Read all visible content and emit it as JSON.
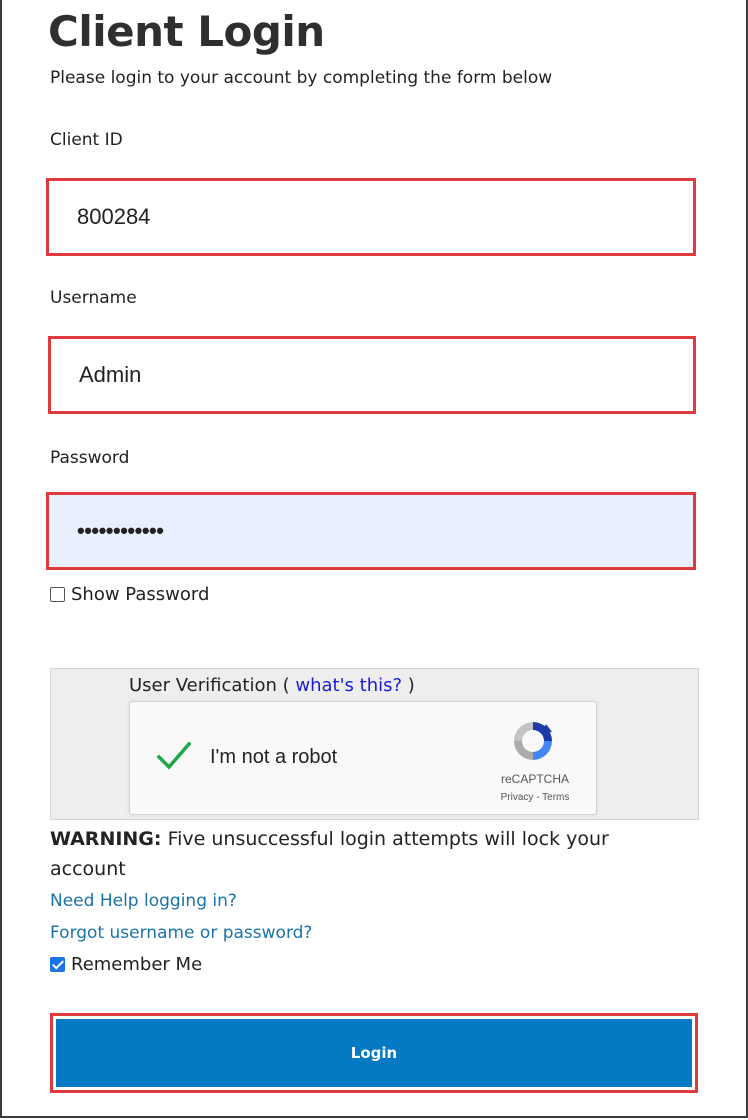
{
  "page": {
    "title": "Client Login",
    "subtitle": "Please login to your account by completing the form below"
  },
  "form": {
    "client_id": {
      "label": "Client ID",
      "value": "800284"
    },
    "username": {
      "label": "Username",
      "value": "Admin"
    },
    "password": {
      "label": "Password",
      "value": "••••••••••••"
    },
    "show_password": {
      "label": "Show Password",
      "checked": false
    }
  },
  "verification": {
    "label": "User Verification (",
    "link_text": "what's this?",
    "label_close": ")",
    "captcha_text": "I'm not a robot",
    "captcha_brand": "reCAPTCHA",
    "captcha_links": "Privacy - Terms",
    "captcha_checked": true
  },
  "warning": {
    "prefix": "WARNING:",
    "text": "Five unsuccessful login attempts will lock your account"
  },
  "links": {
    "help": "Need Help logging in?",
    "forgot": "Forgot username or password?"
  },
  "remember_me": {
    "label": "Remember Me",
    "checked": true
  },
  "login_button": {
    "label": "Login"
  },
  "colors": {
    "highlight_border": "#e0393e",
    "button_bg": "#0679c5",
    "link": "#1a73a8",
    "password_bg": "#e8f0fe"
  }
}
